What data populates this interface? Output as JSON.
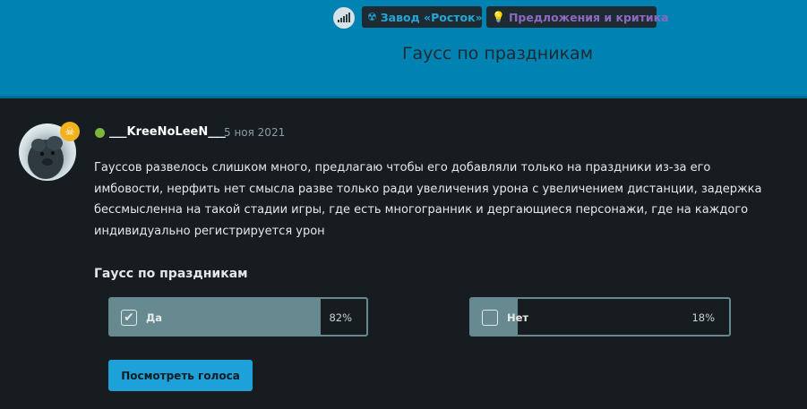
{
  "header": {
    "forum_tags": [
      {
        "label": "Завод «Росток»",
        "icon": "radiation-icon",
        "color": "#25a6d6"
      },
      {
        "label": "Предложения и критика",
        "icon": "lightbulb-icon",
        "color": "#8d69c0"
      }
    ],
    "page_title": "Гаусс по праздникам",
    "accent_color": "#0083b2"
  },
  "post": {
    "author": "___KreeNoLeeN___",
    "date": "5 ноя 2021",
    "online_status_color": "#7cb63a",
    "text": "Гауссов развелось слишком много, предлагаю чтобы его добавляли только на праздники из-за его имбовости, нерфить нет смысла разве только ради увеличения урона с увеличением дистанции, задержка бессмысленна на такой стадии игры, где есть многогранник и дергающиеся персонажи, где на каждого индивидуально регистрируется урон"
  },
  "poll": {
    "title": "Гаусс по праздникам",
    "options": [
      {
        "label": "Да",
        "percent": "82%",
        "fraction": 0.82,
        "checked": true
      },
      {
        "label": "Нет",
        "percent": "18%",
        "fraction": 0.18,
        "checked": false
      }
    ],
    "view_votes_label": "Посмотреть голоса"
  }
}
